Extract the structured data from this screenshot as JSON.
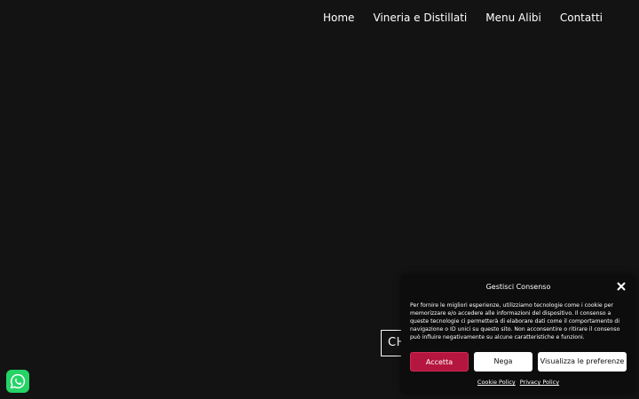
{
  "nav": {
    "items": [
      {
        "label": "Home"
      },
      {
        "label": "Vineria e Distillati"
      },
      {
        "label": "Menu Alibi"
      },
      {
        "label": "Contatti"
      }
    ]
  },
  "cta": {
    "label": "CH"
  },
  "whatsapp": {
    "icon": "whatsapp-icon",
    "color": "#25d366"
  },
  "consent": {
    "title": "Gestisci Consenso",
    "close_icon": "close-icon",
    "text": "Per fornire le migliori esperienze, utilizziamo tecnologie come i cookie per memorizzare e/o accedere alle informazioni del dispositivo. Il consenso a queste tecnologie ci permetterà di elaborare dati come il comportamento di navigazione o ID unici su questo sito. Non acconsentire o ritirare il consenso può influire negativamente su alcune caratteristiche e funzioni.",
    "buttons": {
      "accept": "Accetta",
      "deny": "Nega",
      "preferences": "Visualizza le preferenze"
    },
    "links": {
      "cookie_policy": "Cookie Policy",
      "privacy_policy": "Privacy Policy"
    },
    "accent_color": "#b5163f"
  }
}
